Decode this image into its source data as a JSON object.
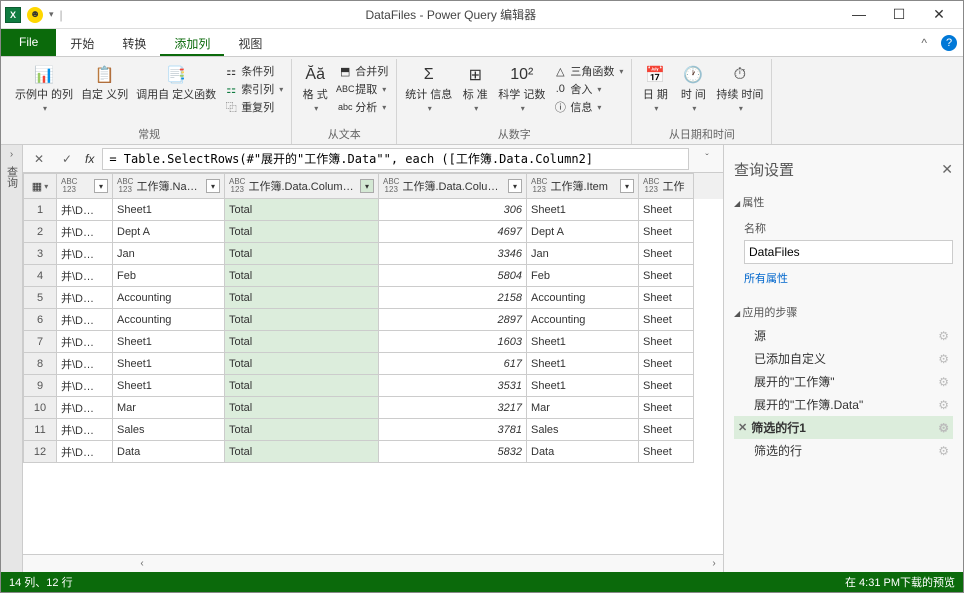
{
  "title": "DataFiles - Power Query 编辑器",
  "win_controls": {
    "min": "—",
    "max": "☐",
    "close": "✕"
  },
  "tabs": {
    "file": "File",
    "home": "开始",
    "transform": "转换",
    "addcol": "添加列",
    "view": "视图"
  },
  "ribbon": {
    "general": {
      "label": "常规",
      "example_col": "示例中\n的列",
      "custom_col": "自定\n义列",
      "invoke_fn": "调用自\n定义函数",
      "conditional": "条件列",
      "index": "索引列",
      "duplicate": "重复列"
    },
    "from_text": {
      "label": "从文本",
      "format": "格\n式",
      "merge": "合并列",
      "extract": "提取",
      "parse": "分析"
    },
    "from_number": {
      "label": "从数字",
      "stats": "统计\n信息",
      "standard": "标\n准",
      "scientific": "科学\n记数",
      "trig": "三角函数",
      "round": "舍入",
      "info": "信息"
    },
    "from_datetime": {
      "label": "从日期和时间",
      "date": "日\n期",
      "time": "时\n间",
      "duration": "持续\n时间"
    }
  },
  "formula": "= Table.SelectRows(#\"展开的\"工作簿.Data\"\", each ([工作簿.Data.Column2]",
  "columns": [
    {
      "label": "",
      "w": "w-source",
      "filter": true
    },
    {
      "label": "工作簿.Na…",
      "w": "w-name",
      "filter": true
    },
    {
      "label": "工作簿.Data.Colum…",
      "w": "w-col1",
      "filter": true,
      "filtered": true
    },
    {
      "label": "工作簿.Data.Colum…",
      "w": "w-col2",
      "filter": true
    },
    {
      "label": "工作簿.Item",
      "w": "w-item",
      "filter": true
    },
    {
      "label": "工作",
      "w": "w-last",
      "filter": false
    }
  ],
  "type_badge_top": "ABC",
  "type_badge_bot": "123",
  "rows": [
    {
      "n": 1,
      "c0": "并\\D…",
      "c1": "Sheet1",
      "c2": "Total",
      "c3": "306",
      "c4": "Sheet1",
      "c5": "Sheet"
    },
    {
      "n": 2,
      "c0": "并\\D…",
      "c1": "Dept A",
      "c2": "Total",
      "c3": "4697",
      "c4": "Dept A",
      "c5": "Sheet"
    },
    {
      "n": 3,
      "c0": "并\\D…",
      "c1": "Jan",
      "c2": "Total",
      "c3": "3346",
      "c4": "Jan",
      "c5": "Sheet"
    },
    {
      "n": 4,
      "c0": "并\\D…",
      "c1": "Feb",
      "c2": "Total",
      "c3": "5804",
      "c4": "Feb",
      "c5": "Sheet"
    },
    {
      "n": 5,
      "c0": "并\\D…",
      "c1": "Accounting",
      "c2": "Total",
      "c3": "2158",
      "c4": "Accounting",
      "c5": "Sheet"
    },
    {
      "n": 6,
      "c0": "并\\D…",
      "c1": "Accounting",
      "c2": "Total",
      "c3": "2897",
      "c4": "Accounting",
      "c5": "Sheet"
    },
    {
      "n": 7,
      "c0": "并\\D…",
      "c1": "Sheet1",
      "c2": "Total",
      "c3": "1603",
      "c4": "Sheet1",
      "c5": "Sheet"
    },
    {
      "n": 8,
      "c0": "并\\D…",
      "c1": "Sheet1",
      "c2": "Total",
      "c3": "617",
      "c4": "Sheet1",
      "c5": "Sheet"
    },
    {
      "n": 9,
      "c0": "并\\D…",
      "c1": "Sheet1",
      "c2": "Total",
      "c3": "3531",
      "c4": "Sheet1",
      "c5": "Sheet"
    },
    {
      "n": 10,
      "c0": "并\\D…",
      "c1": "Mar",
      "c2": "Total",
      "c3": "3217",
      "c4": "Mar",
      "c5": "Sheet"
    },
    {
      "n": 11,
      "c0": "并\\D…",
      "c1": "Sales",
      "c2": "Total",
      "c3": "3781",
      "c4": "Sales",
      "c5": "Sheet"
    },
    {
      "n": 12,
      "c0": "并\\D…",
      "c1": "Data",
      "c2": "Total",
      "c3": "5832",
      "c4": "Data",
      "c5": "Sheet"
    }
  ],
  "settings": {
    "title": "查询设置",
    "prop_section": "属性",
    "name_label": "名称",
    "name_value": "DataFiles",
    "all_props": "所有属性",
    "steps_section": "应用的步骤",
    "steps": [
      {
        "label": "源",
        "gear": true
      },
      {
        "label": "已添加自定义",
        "gear": true
      },
      {
        "label": "展开的\"工作簿\"",
        "gear": true
      },
      {
        "label": "展开的\"工作簿.Data\"",
        "gear": true
      },
      {
        "label": "筛选的行1",
        "gear": true,
        "selected": true,
        "del": true
      },
      {
        "label": "筛选的行",
        "gear": true
      }
    ]
  },
  "status": {
    "left": "14 列、12 行",
    "right": "在 4:31 PM下载的预览"
  },
  "left_rail": "查询"
}
